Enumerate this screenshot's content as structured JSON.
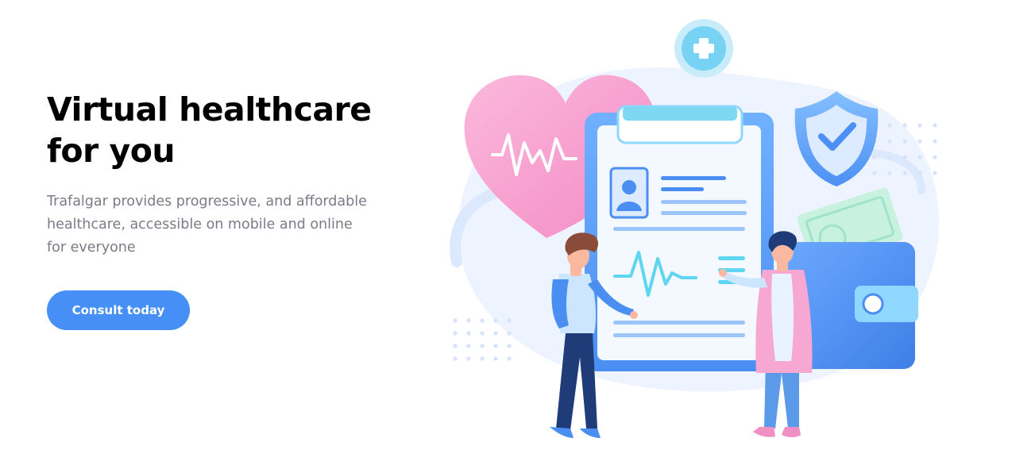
{
  "hero": {
    "title_line1": "Virtual healthcare",
    "title_line2": "for you",
    "description_line1": "Trafalgar provides progressive, and affordable",
    "description_line2": "healthcare, accessible on mobile and online",
    "description_line3": "for everyone",
    "cta_label": "Consult today"
  },
  "illustration": {
    "icons": [
      "plus-circle-icon",
      "heart-icon",
      "shield-check-icon",
      "clipboard-icon",
      "wallet-icon",
      "patient-figure",
      "doctor-figure"
    ],
    "colors": {
      "accent": "#458ff6",
      "heart_pink": "#f8a1cf",
      "light_blue": "#e8f1ff",
      "cyan": "#5fd6f1"
    }
  }
}
